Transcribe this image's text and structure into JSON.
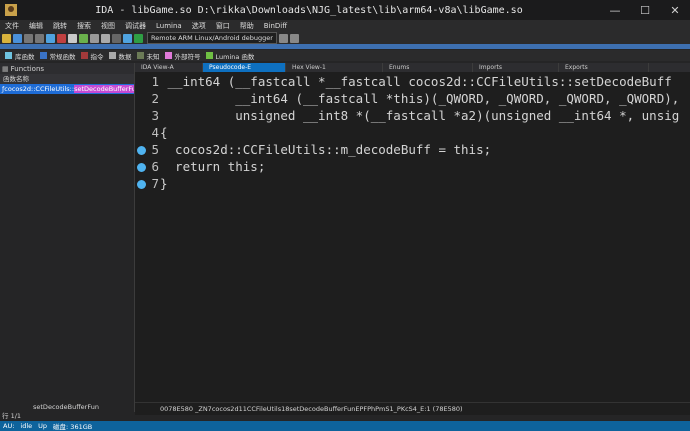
{
  "window": {
    "title": "IDA - libGame.so D:\\rikka\\Downloads\\NJG_latest\\lib\\arm64-v8a\\libGame.so",
    "min": "—",
    "max": "☐",
    "close": "✕"
  },
  "menu": [
    "文件",
    "编辑",
    "跳转",
    "搜索",
    "视图",
    "调试器",
    "Lumina",
    "选项",
    "窗口",
    "帮助",
    "BinDiff"
  ],
  "toolbar": {
    "debugger_label": "Remote ARM Linux/Android debugger"
  },
  "legend": [
    {
      "label": "库函数",
      "color": "#6fc3df"
    },
    {
      "label": "常规函数",
      "color": "#3a73c6"
    },
    {
      "label": "指令",
      "color": "#a33a3a"
    },
    {
      "label": "数据",
      "color": "#a9a9a9"
    },
    {
      "label": "未知",
      "color": "#6b7a56"
    },
    {
      "label": "外部符号",
      "color": "#e07ad9"
    },
    {
      "label": "Lumina 函数",
      "color": "#6fbf43"
    }
  ],
  "functions": {
    "title": "Functions",
    "column": "函数名称",
    "row_prefix": "cocos2d::CCFileUtils::",
    "row_hl": "setDecodeBufferFun(",
    "search_text": "setDecodeBufferFun",
    "counter": "行 1/1"
  },
  "tabs": [
    {
      "label": "IDA View-A",
      "active": false
    },
    {
      "label": "Pseudocode-E",
      "active": true
    },
    {
      "label": "Hex View-1",
      "active": false
    },
    {
      "label": "Enums",
      "active": false
    },
    {
      "label": "Imports",
      "active": false
    },
    {
      "label": "Exports",
      "active": false
    }
  ],
  "code": [
    {
      "n": "1",
      "text": " __int64 (__fastcall *__fastcall cocos2d::CCFileUtils::setDecodeBuff"
    },
    {
      "n": "2",
      "text": "          __int64 (__fastcall *this)(_QWORD, _QWORD, _QWORD, _QWORD),"
    },
    {
      "n": "3",
      "text": "          unsigned __int8 *(__fastcall *a2)(unsigned __int64 *, unsig"
    },
    {
      "n": "4",
      "text": "{"
    },
    {
      "n": "5",
      "text": "  cocos2d::CCFileUtils::m_decodeBuff = this;"
    },
    {
      "n": "6",
      "text": "  return this;"
    },
    {
      "n": "7",
      "text": "}"
    }
  ],
  "address_line": "0078E580 _ZN7cocos2d11CCFileUtils18setDecodeBufferFunEPFPhPmS1_PKcS4_E:1 (78E580)",
  "status": {
    "au": "AU:",
    "state": "idle",
    "up": "Up",
    "disk": "磁盘: 361GB"
  }
}
